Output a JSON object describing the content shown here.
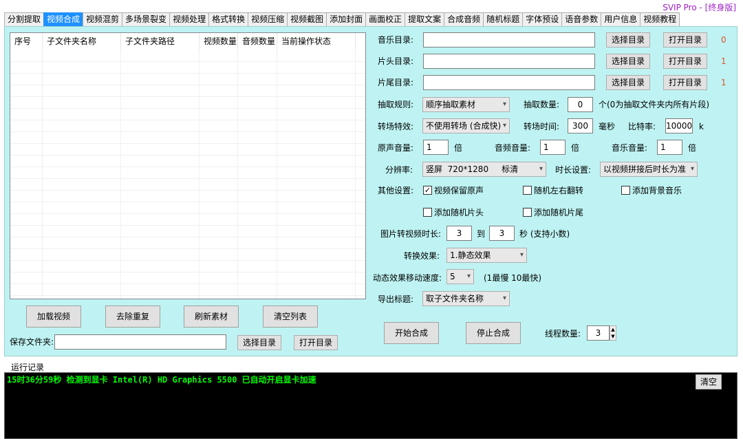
{
  "header": {
    "svip": "SVIP Pro - [终身版]"
  },
  "tabs": [
    "分割提取",
    "视频合成",
    "视频混剪",
    "多场景裂变",
    "视频处理",
    "格式转换",
    "视频压缩",
    "视频截图",
    "添加封面",
    "画面校正",
    "提取文案",
    "合成音频",
    "随机标题",
    "字体预设",
    "语音参数",
    "用户信息",
    "视频教程"
  ],
  "list": {
    "columns": [
      "序号",
      "子文件夹名称",
      "子文件夹路径",
      "视频数量",
      "音频数量",
      "当前操作状态"
    ]
  },
  "left_buttons": {
    "load": "加载视频",
    "dedupe": "去除重复",
    "refresh": "刷新素材",
    "clear": "清空列表"
  },
  "save": {
    "label": "保存文件夹:",
    "value": "",
    "choose": "选择目录",
    "open": "打开目录"
  },
  "dirs": {
    "music": {
      "label": "音乐目录:",
      "value": "",
      "choose": "选择目录",
      "open": "打开目录",
      "count": "0"
    },
    "intro": {
      "label": "片头目录:",
      "value": "",
      "choose": "选择目录",
      "open": "打开目录",
      "count": "1"
    },
    "outro": {
      "label": "片尾目录:",
      "value": "",
      "choose": "选择目录",
      "open": "打开目录",
      "count": "1"
    }
  },
  "extract": {
    "rule_label": "抽取规则:",
    "rule_value": "顺序抽取素材",
    "count_label": "抽取数量:",
    "count_value": "0",
    "count_hint": "个(0为抽取文件夹内所有片段)"
  },
  "transition": {
    "effect_label": "转场特效:",
    "effect_value": "不使用转场 (合成快)",
    "time_label": "转场时间:",
    "time_value": "300",
    "time_unit": "毫秒",
    "bitrate_label": "比特率:",
    "bitrate_value": "10000",
    "bitrate_unit": "k"
  },
  "volume": {
    "orig_label": "原声音量:",
    "orig_value": "1",
    "audio_label": "音频音量:",
    "audio_value": "1",
    "music_label": "音乐音量:",
    "music_value": "1",
    "unit": "倍"
  },
  "resolution": {
    "label": "分辨率:",
    "value": "竖屏  720*1280     标清",
    "duration_label": "时长设置:",
    "duration_value": "以视频拼接后时长为准"
  },
  "other": {
    "label": "其他设置:",
    "keep_orig": {
      "text": "视频保留原声",
      "checked": true
    },
    "random_flip": {
      "text": "随机左右翻转",
      "checked": false
    },
    "add_bgm": {
      "text": "添加背景音乐",
      "checked": false
    },
    "random_intro": {
      "text": "添加随机片头",
      "checked": false
    },
    "random_outro": {
      "text": "添加随机片尾",
      "checked": false
    }
  },
  "image": {
    "label": "图片转视频时长:",
    "from": "3",
    "to_label": "到",
    "to": "3",
    "unit": "秒 (支持小数)"
  },
  "effect": {
    "label": "转换效果:",
    "value": "1.静态效果"
  },
  "speed": {
    "label": "动态效果移动速度:",
    "value": "5",
    "hint": "(1最慢 10最快)"
  },
  "export": {
    "label": "导出标题:",
    "value": "取子文件夹名称"
  },
  "actions": {
    "start": "开始合成",
    "stop": "停止合成",
    "threads_label": "线程数量:",
    "threads_value": "3"
  },
  "log": {
    "title": "运行记录",
    "line": "15时36分59秒 检测到显卡 Intel(R) HD Graphics 5500 已自动开启显卡加速",
    "clear": "清空"
  }
}
